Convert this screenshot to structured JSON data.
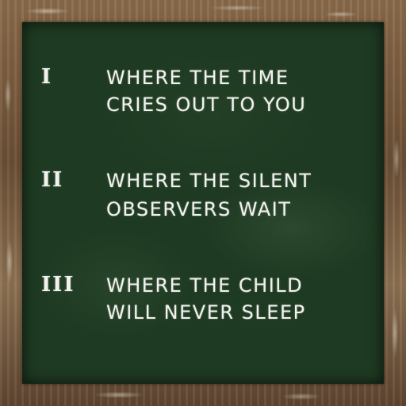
{
  "board": {
    "entries": [
      {
        "numeral": "I",
        "line1": "WHERE THE TIME",
        "line2": "CRIES OUT TO YOU"
      },
      {
        "numeral": "II",
        "line1": "WHERE THE SILENT",
        "line2": "OBSERVERS WAIT"
      },
      {
        "numeral": "III",
        "line1": "WHERE THE CHILD",
        "line2": "WILL NEVER SLEEP"
      }
    ]
  },
  "colors": {
    "chalkboard": "#1e3a22",
    "chalk": "#f2f2ee",
    "frame_wood": "#6b4f35"
  }
}
